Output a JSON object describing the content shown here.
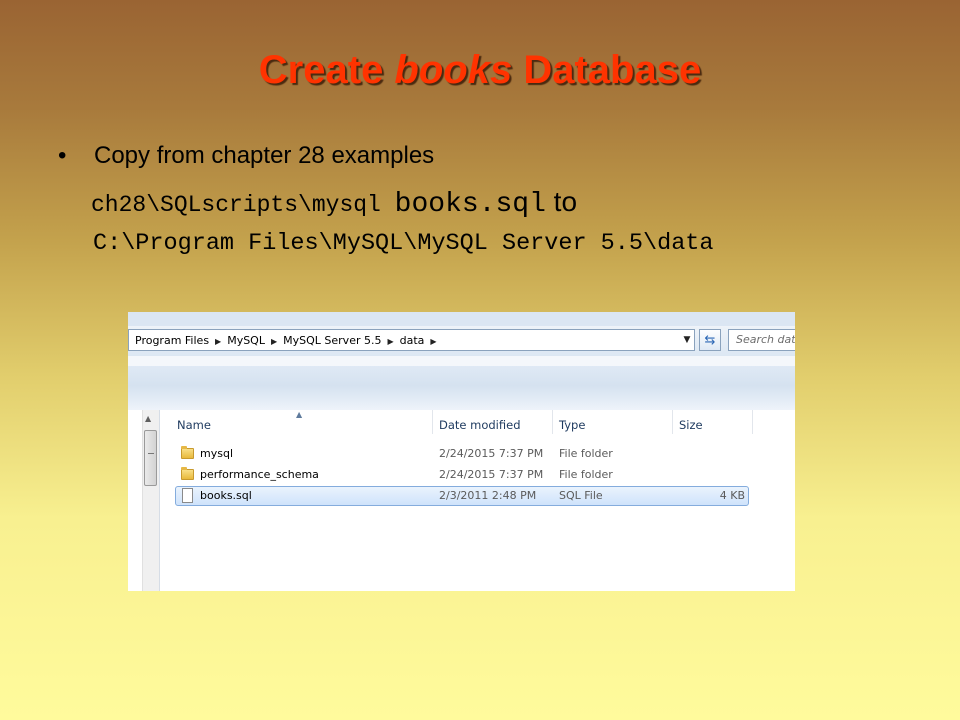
{
  "slide": {
    "title_pre": "Create ",
    "title_em": "books",
    "title_post": " Database",
    "bullet_mark": "•",
    "bullet_text": "Copy from chapter 28 examples",
    "path_dir": "ch28\\SQLscripts\\mysql ",
    "path_file": "books.sql",
    "path_to": " to",
    "dest_path": "C:\\Program Files\\MySQL\\MySQL Server 5.5\\data"
  },
  "explorer": {
    "breadcrumbs": [
      "Program Files",
      "MySQL",
      "MySQL Server 5.5",
      "data"
    ],
    "search_placeholder": "Search data",
    "columns": {
      "name": "Name",
      "date": "Date modified",
      "type": "Type",
      "size": "Size"
    },
    "rows": [
      {
        "name": "mysql",
        "date": "2/24/2015 7:37 PM",
        "type": "File folder",
        "size": "",
        "icon": "folder-icon"
      },
      {
        "name": "performance_schema",
        "date": "2/24/2015 7:37 PM",
        "type": "File folder",
        "size": "",
        "icon": "folder-icon"
      },
      {
        "name": "books.sql",
        "date": "2/3/2011 2:48 PM",
        "type": "SQL File",
        "size": "4 KB",
        "icon": "file-icon"
      }
    ]
  }
}
